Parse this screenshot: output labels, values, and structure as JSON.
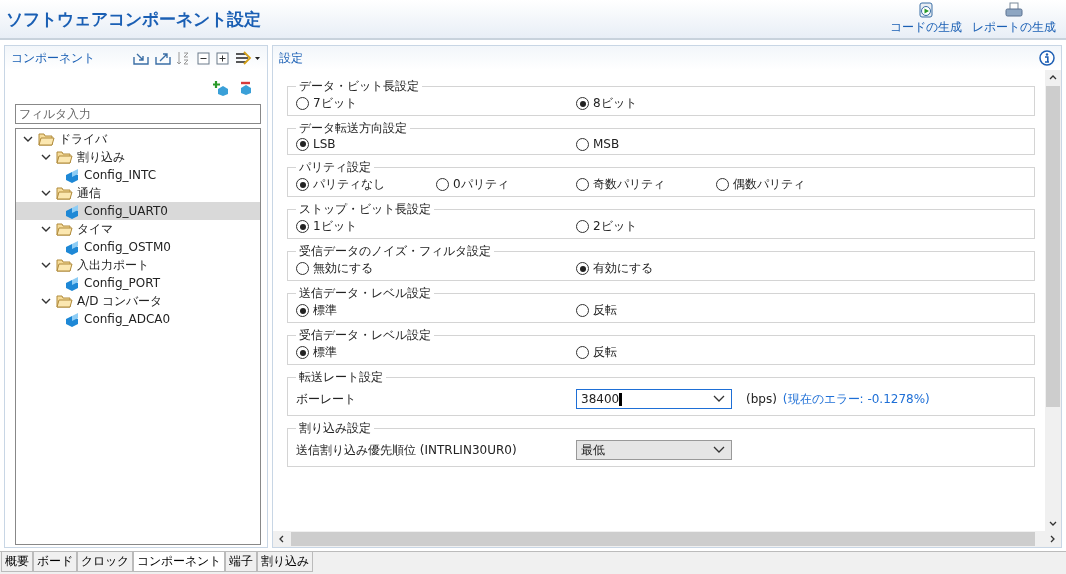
{
  "title": "ソフトウェアコンポーネント設定",
  "header_actions": [
    {
      "label": "コードの生成",
      "kind": "code"
    },
    {
      "label": "レポートの生成",
      "kind": "report"
    }
  ],
  "component_panel": {
    "title": "コンポーネント",
    "filter": {
      "placeholder": "フィルタ入力"
    },
    "tree": [
      {
        "label": "ドライバ",
        "kind": "folder",
        "expanded": true,
        "selected": false,
        "children": [
          {
            "label": "割り込み",
            "kind": "folder",
            "expanded": true,
            "selected": false,
            "children": [
              {
                "label": "Config_INTC",
                "kind": "component",
                "selected": false
              }
            ]
          },
          {
            "label": "通信",
            "kind": "folder",
            "expanded": true,
            "selected": false,
            "children": [
              {
                "label": "Config_UART0",
                "kind": "component",
                "selected": true
              }
            ]
          },
          {
            "label": "タイマ",
            "kind": "folder",
            "expanded": true,
            "selected": false,
            "children": [
              {
                "label": "Config_OSTM0",
                "kind": "component",
                "selected": false
              }
            ]
          },
          {
            "label": "入出力ポート",
            "kind": "folder",
            "expanded": true,
            "selected": false,
            "children": [
              {
                "label": "Config_PORT",
                "kind": "component",
                "selected": false
              }
            ]
          },
          {
            "label": "A/D コンバータ",
            "kind": "folder",
            "expanded": true,
            "selected": false,
            "children": [
              {
                "label": "Config_ADCA0",
                "kind": "component",
                "selected": false
              }
            ]
          }
        ]
      }
    ]
  },
  "settings_panel": {
    "title": "設定",
    "groups": [
      {
        "legend": "データ・ビット長設定",
        "kind": "radio",
        "options": [
          {
            "label": "7ビット",
            "selected": false
          },
          {
            "label": "8ビット",
            "selected": true
          }
        ]
      },
      {
        "legend": "データ転送方向設定",
        "kind": "radio",
        "options": [
          {
            "label": "LSB",
            "selected": true
          },
          {
            "label": "MSB",
            "selected": false
          }
        ]
      },
      {
        "legend": "パリティ設定",
        "kind": "radio",
        "options": [
          {
            "label": "パリティなし",
            "selected": true
          },
          {
            "label": "0パリティ",
            "selected": false
          },
          {
            "label": "奇数パリティ",
            "selected": false
          },
          {
            "label": "偶数パリティ",
            "selected": false
          }
        ]
      },
      {
        "legend": "ストップ・ビット長設定",
        "kind": "radio",
        "options": [
          {
            "label": "1ビット",
            "selected": true
          },
          {
            "label": "2ビット",
            "selected": false
          }
        ]
      },
      {
        "legend": "受信データのノイズ・フィルタ設定",
        "kind": "radio",
        "options": [
          {
            "label": "無効にする",
            "selected": false
          },
          {
            "label": "有効にする",
            "selected": true
          }
        ]
      },
      {
        "legend": "送信データ・レベル設定",
        "kind": "radio",
        "options": [
          {
            "label": "標準",
            "selected": true
          },
          {
            "label": "反転",
            "selected": false
          }
        ]
      },
      {
        "legend": "受信データ・レベル設定",
        "kind": "radio",
        "options": [
          {
            "label": "標準",
            "selected": true
          },
          {
            "label": "反転",
            "selected": false
          }
        ]
      },
      {
        "legend": "転送レート設定",
        "kind": "combo",
        "label": "ボーレート",
        "value": "38400",
        "editable": true,
        "unit": "(bps)",
        "note": "(現在のエラー: -0.1278%)"
      },
      {
        "legend": "割り込み設定",
        "kind": "combo",
        "label": "送信割り込み優先順位 (INTRLIN30UR0)",
        "value": "最低",
        "editable": false
      }
    ]
  },
  "bottom_tabs": [
    {
      "label": "概要",
      "selected": false
    },
    {
      "label": "ボード",
      "selected": false
    },
    {
      "label": "クロック",
      "selected": false
    },
    {
      "label": "コンポーネント",
      "selected": true
    },
    {
      "label": "端子",
      "selected": false
    },
    {
      "label": "割り込み",
      "selected": false
    }
  ]
}
